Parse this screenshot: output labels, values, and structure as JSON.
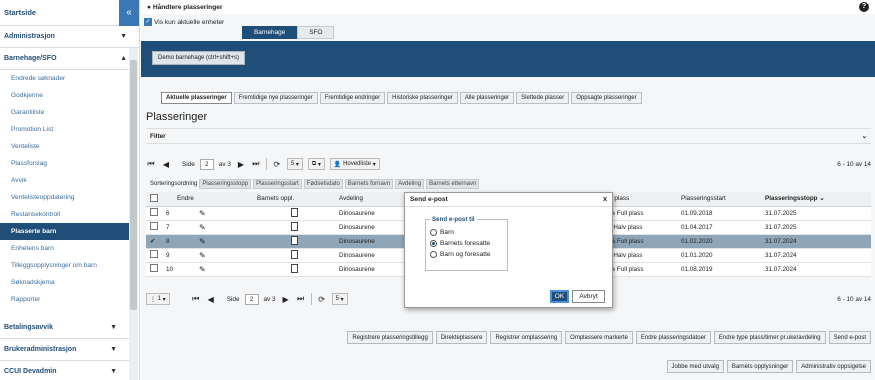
{
  "sidebar": {
    "home": "Startside",
    "collapse": "«",
    "sections": [
      {
        "label": "Administrasjon"
      },
      {
        "label": "Barnehage/SFO"
      }
    ],
    "items": [
      "Endrede søknader",
      "Godkjenne",
      "Garantiliste",
      "Promotion List",
      "Venteliste",
      "Plassforslag",
      "Avvik",
      "Ventelisteoppdatering",
      "Restansekontroll",
      "Plasserte barn",
      "Enhetens barn",
      "Tilleggsopplysninger om barn",
      "Søknadskjema",
      "Rapporter"
    ],
    "bottom": [
      {
        "label": "Betalingsavvik"
      },
      {
        "label": "Brukeradministrasjon"
      },
      {
        "label": "CCUI Devadmin"
      }
    ]
  },
  "topbar": {
    "title": "Håndtere plasseringer",
    "help": "?"
  },
  "filter_check": {
    "label": "Vis kun aktuelle enheter",
    "checked": "✓"
  },
  "tabs": [
    "Barnehage",
    "SFO"
  ],
  "demo_button": "Demo barnehage (ctrl+shift+s)",
  "subtabs": [
    "Aktuelle plasseringer",
    "Fremtidige nye plasseringer",
    "Fremtidige endringer",
    "Historiske plasseringer",
    "Alle plasseringer",
    "Slettede plasser",
    "Oppsagte plasseringer"
  ],
  "section_title": "Plasseringer",
  "filter_label": "Filter",
  "pager": {
    "side_label": "Side",
    "page": "2",
    "of": "av 3",
    "size": "5",
    "view": "Hovedliste",
    "range": "6 - 10 av 14",
    "size2": "1"
  },
  "sort": {
    "label": "Sorteringsordning",
    "chips": [
      "Plasseringsstopp",
      "Plasseringsstart",
      "Fødselsdato",
      "Barnets fornavn",
      "Avdeling",
      "Barnets etternavn"
    ]
  },
  "grid": {
    "headers": [
      "Endre",
      "Barnets oppl.",
      "Avdeling",
      "Type plass",
      "Plasseringsstart",
      "Plasseringsstopp"
    ],
    "rows": [
      {
        "n": "6",
        "avd": "Dinosaurene",
        "type": "100% Full plass",
        "start": "01.09.2018",
        "stop": "31.07.2025"
      },
      {
        "n": "7",
        "avd": "Dinosaurene",
        "type": "50% Halv plass",
        "start": "01.04.2017",
        "stop": "31.07.2025"
      },
      {
        "n": "8",
        "avd": "Dinosaurene",
        "type": "100% Full plass",
        "start": "01.02.2020",
        "stop": "31.07.2024"
      },
      {
        "n": "9",
        "avd": "Dinosaurene",
        "type": "50% Halv plass",
        "start": "01.01.2020",
        "stop": "31.07.2024"
      },
      {
        "n": "10",
        "avd": "Dinosaurene",
        "type": "100% Full plass",
        "start": "01.08.2019",
        "stop": "31.07.2024"
      }
    ]
  },
  "actions1": [
    "Registrere plasseringstillegg",
    "Direkteplassere",
    "Registrer omplassering",
    "Omplassere markerte",
    "Endre plasseringsdatoer",
    "Endre type plass/timer pr.uke/avdeling",
    "Send e-post"
  ],
  "actions2": [
    "Jobbe med utvalg",
    "Barnets opplysninger",
    "Administrativ oppsigelse"
  ],
  "modal": {
    "title": "Send e-post",
    "close": "x",
    "legend": "Send e-post til",
    "options": [
      "Barn",
      "Barnets foresatte",
      "Barn og foresatte"
    ],
    "selected_index": 1,
    "ok": "OK",
    "cancel": "Avbryt"
  }
}
